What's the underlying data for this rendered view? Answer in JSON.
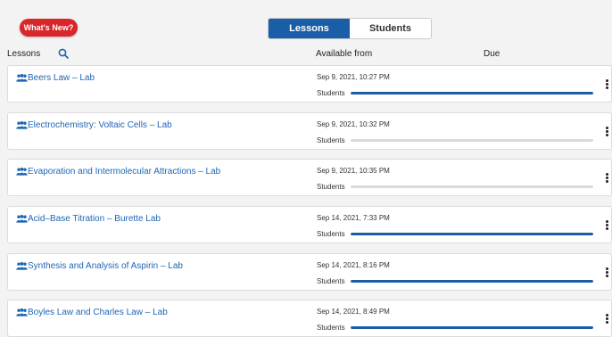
{
  "whats_new_label": "What's New?",
  "tabs": [
    {
      "label": "Lessons",
      "active": true
    },
    {
      "label": "Students",
      "active": false
    }
  ],
  "columns": {
    "lessons": "Lessons",
    "available_from": "Available from",
    "due": "Due"
  },
  "rows": [
    {
      "title": "Beers Law – Lab",
      "available": "Sep 9, 2021, 10:27 PM",
      "students_label": "Students",
      "progress": 1.0
    },
    {
      "title": "Electrochemistry: Voltaic Cells – Lab",
      "available": "Sep 9, 2021, 10:32 PM",
      "students_label": "Students",
      "progress": 0.0
    },
    {
      "title": "Evaporation and Intermolecular Attractions – Lab",
      "available": "Sep 9, 2021, 10:35 PM",
      "students_label": "Students",
      "progress": 0.0
    },
    {
      "title": "Acid–Base Titration – Burette Lab",
      "available": "Sep 14, 2021, 7:33 PM",
      "students_label": "Students",
      "progress": 1.0
    },
    {
      "title": "Synthesis and Analysis of Aspirin – Lab",
      "available": "Sep 14, 2021, 8:16 PM",
      "students_label": "Students",
      "progress": 1.0
    },
    {
      "title": "Boyles Law and Charles Law – Lab",
      "available": "Sep 14, 2021, 8:49 PM",
      "students_label": "Students",
      "progress": 1.0
    }
  ],
  "colors": {
    "accent": "#1a5ea8",
    "whats_new": "#d9262b",
    "link": "#1e66b5",
    "track": "#dadada"
  },
  "icons": {
    "search": "search-icon",
    "lesson": "group-icon",
    "menu": "more-vertical-icon"
  }
}
